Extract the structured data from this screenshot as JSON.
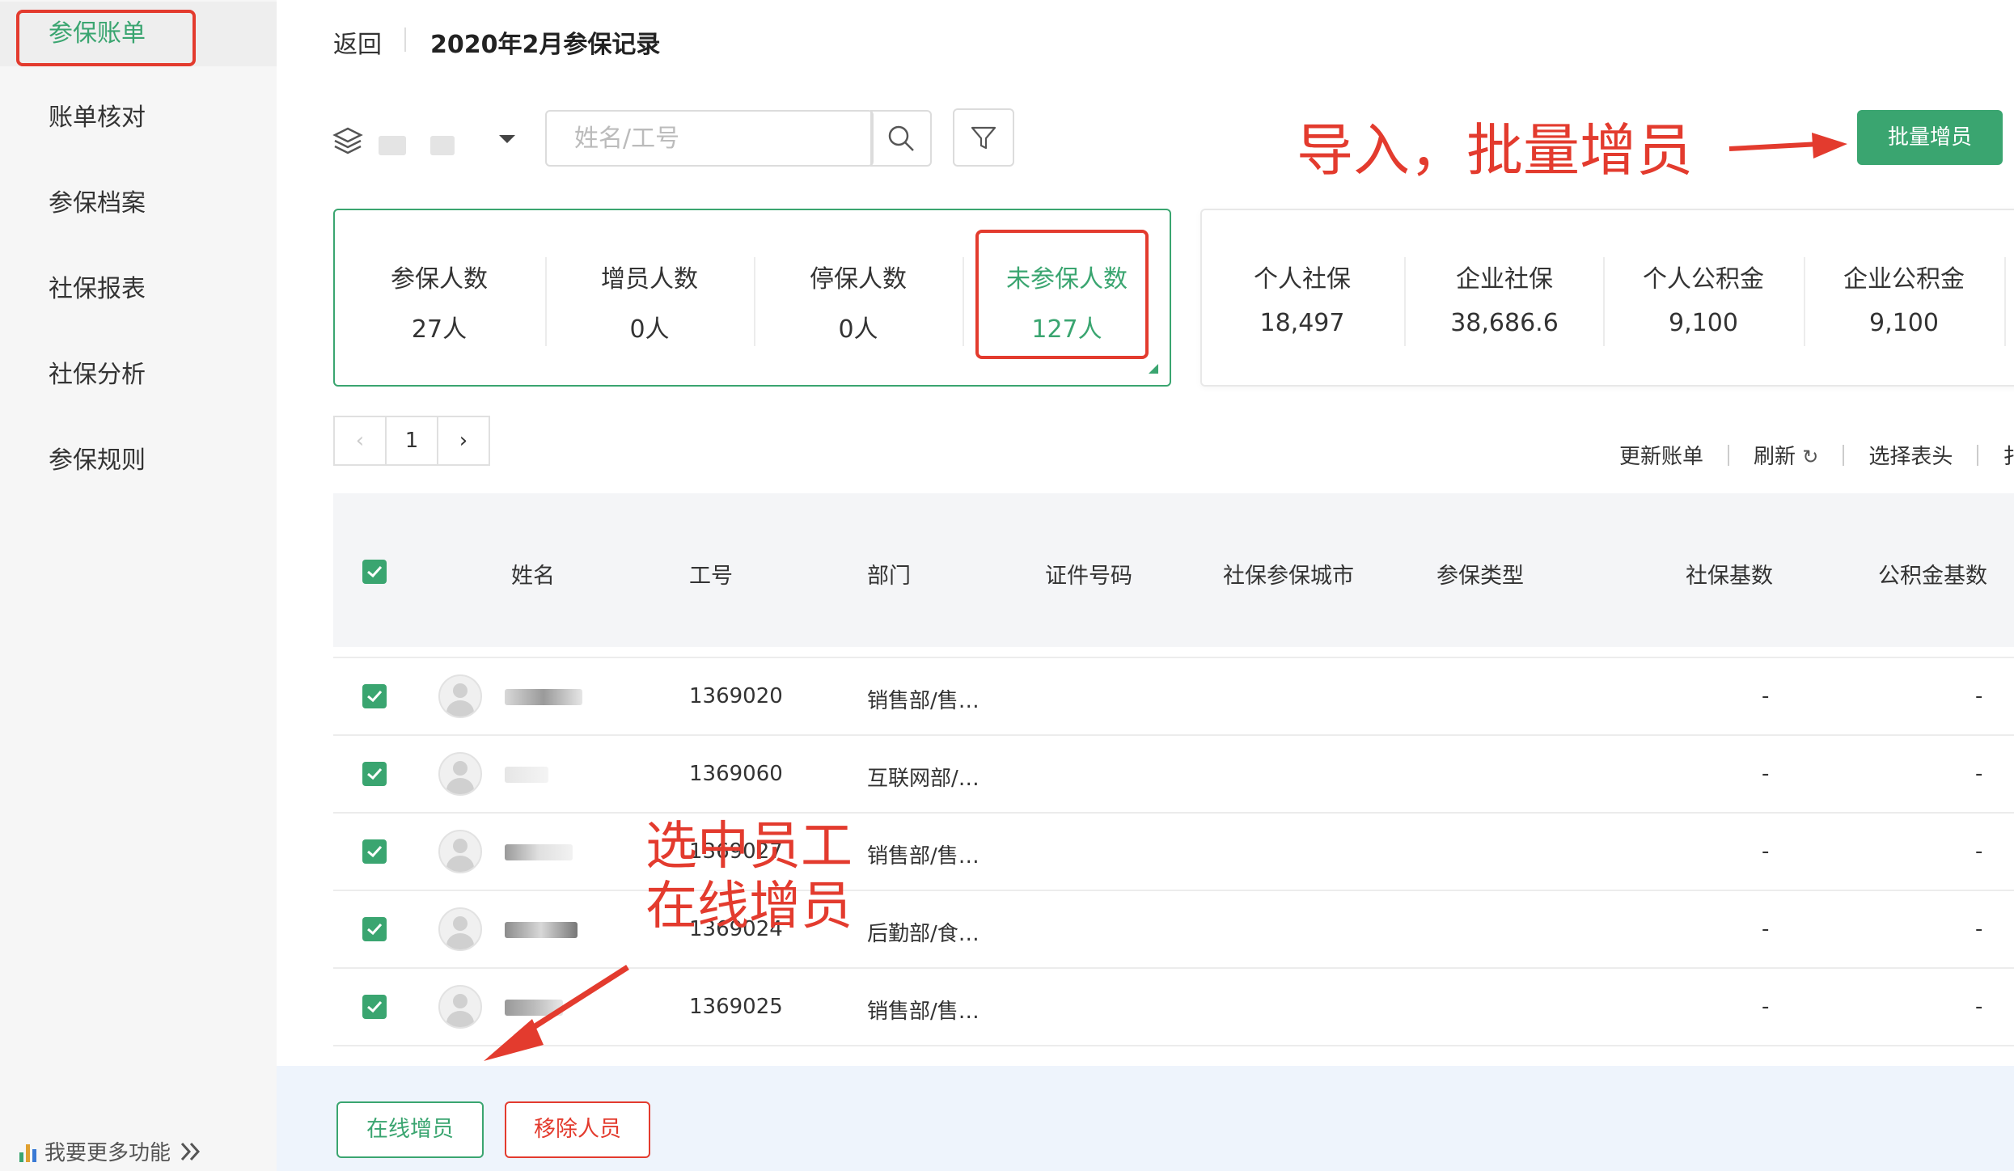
{
  "sidebar": {
    "items": [
      {
        "label": "参保账单"
      },
      {
        "label": "账单核对"
      },
      {
        "label": "参保档案"
      },
      {
        "label": "社保报表"
      },
      {
        "label": "社保分析"
      },
      {
        "label": "参保规则"
      }
    ],
    "more_label": "我要更多功能",
    "more_icon": "double-chevron-right-icon"
  },
  "header": {
    "back_label": "返回",
    "title": "2020年2月参保记录"
  },
  "toolbar": {
    "search_placeholder": "姓名/工号",
    "batch_add_label": "批量增员"
  },
  "stats_left": [
    {
      "label": "参保人数",
      "value": "27人"
    },
    {
      "label": "增员人数",
      "value": "0人"
    },
    {
      "label": "停保人数",
      "value": "0人"
    },
    {
      "label": "未参保人数",
      "value": "127人"
    }
  ],
  "stats_right": [
    {
      "label": "个人社保",
      "value": "18,497"
    },
    {
      "label": "企业社保",
      "value": "38,686.6"
    },
    {
      "label": "个人公积金",
      "value": "9,100"
    },
    {
      "label": "企业公积金",
      "value": "9,100"
    }
  ],
  "pagination": {
    "prev": "‹",
    "current": "1",
    "next": "›"
  },
  "actions": {
    "update_bill": "更新账单",
    "refresh": "刷新",
    "refresh_icon": "↻",
    "select_header": "选择表头",
    "more": "扌"
  },
  "table": {
    "columns": [
      "姓名",
      "工号",
      "部门",
      "证件号码",
      "社保参保城市",
      "参保类型",
      "社保基数",
      "公积金基数"
    ],
    "rows": [
      {
        "id": "1369020",
        "dept": "销售部/售…",
        "social_base": "-",
        "fund_base": "-"
      },
      {
        "id": "1369060",
        "dept": "互联网部/…",
        "social_base": "-",
        "fund_base": "-"
      },
      {
        "id": "1369027",
        "dept": "销售部/售…",
        "social_base": "-",
        "fund_base": "-"
      },
      {
        "id": "1369024",
        "dept": "后勤部/食…",
        "social_base": "-",
        "fund_base": "-"
      },
      {
        "id": "1369025",
        "dept": "销售部/售…",
        "social_base": "-",
        "fund_base": "-"
      }
    ]
  },
  "bottom": {
    "online_add_label": "在线增员",
    "remove_label": "移除人员"
  },
  "annotations": {
    "import_note": "导入，批量增员",
    "select_note_line1": "选中员工",
    "select_note_line2": "在线增员"
  },
  "colors": {
    "accent": "#3aa570",
    "annotation_red": "#e33b2e"
  }
}
